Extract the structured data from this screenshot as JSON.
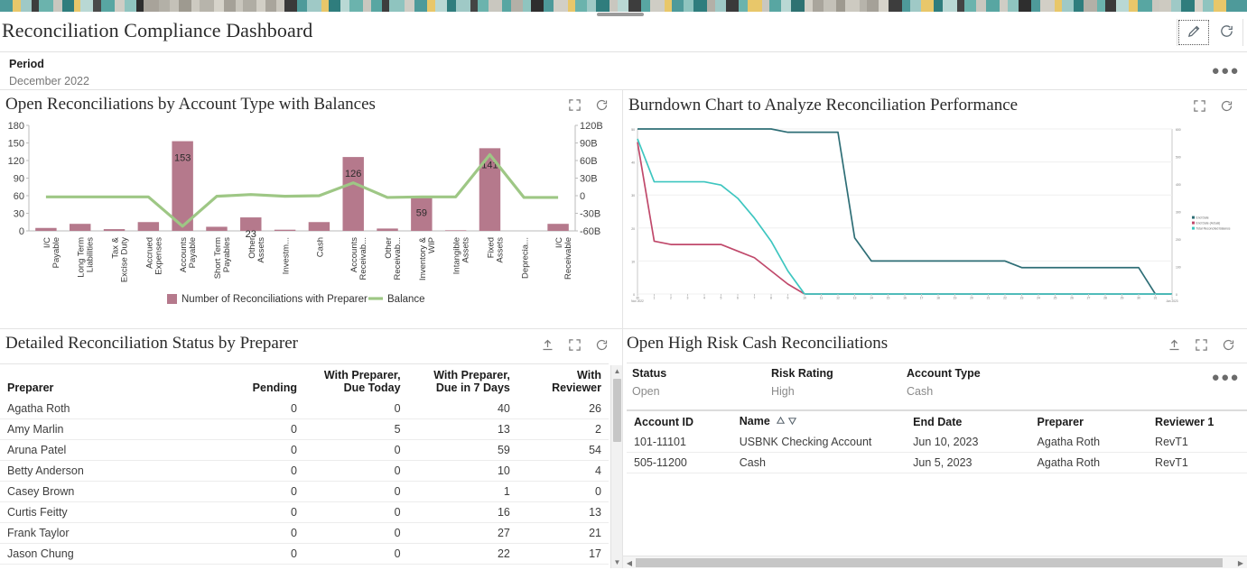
{
  "header": {
    "title": "Reconciliation Compliance Dashboard",
    "edit_icon": "pencil-icon",
    "refresh_icon": "refresh-icon"
  },
  "period": {
    "label": "Period",
    "value": "December 2022",
    "more_icon": "overflow-menu-icon"
  },
  "panel_bar": {
    "title": "Open Reconciliations by Account Type with Balances",
    "maximize_icon": "maximize-icon",
    "refresh_icon": "refresh-icon"
  },
  "panel_burndown": {
    "title": "Burndown Chart to Analyze Reconciliation Performance",
    "maximize_icon": "maximize-icon",
    "refresh_icon": "refresh-icon"
  },
  "panel_preparer": {
    "title": "Detailed Reconciliation Status by Preparer",
    "export_icon": "export-icon",
    "maximize_icon": "maximize-icon",
    "refresh_icon": "refresh-icon",
    "columns": [
      "Preparer",
      "Pending",
      "With Preparer, Due Today",
      "With Preparer, Due in 7 Days",
      "With Reviewer"
    ],
    "rows": [
      {
        "preparer": "Agatha Roth",
        "pending": "0",
        "due_today": "0",
        "due_7days": "40",
        "with_reviewer": "26"
      },
      {
        "preparer": "Amy Marlin",
        "pending": "0",
        "due_today": "5",
        "due_7days": "13",
        "with_reviewer": "2"
      },
      {
        "preparer": "Aruna Patel",
        "pending": "0",
        "due_today": "0",
        "due_7days": "59",
        "with_reviewer": "54"
      },
      {
        "preparer": "Betty Anderson",
        "pending": "0",
        "due_today": "0",
        "due_7days": "10",
        "with_reviewer": "4"
      },
      {
        "preparer": "Casey Brown",
        "pending": "0",
        "due_today": "0",
        "due_7days": "1",
        "with_reviewer": "0"
      },
      {
        "preparer": "Curtis Feitty",
        "pending": "0",
        "due_today": "0",
        "due_7days": "16",
        "with_reviewer": "13"
      },
      {
        "preparer": "Frank Taylor",
        "pending": "0",
        "due_today": "0",
        "due_7days": "27",
        "with_reviewer": "21"
      },
      {
        "preparer": "Jason Chung",
        "pending": "0",
        "due_today": "0",
        "due_7days": "22",
        "with_reviewer": "17"
      }
    ]
  },
  "panel_highrisk": {
    "title": "Open High Risk Cash Reconciliations",
    "export_icon": "export-icon",
    "maximize_icon": "maximize-icon",
    "refresh_icon": "refresh-icon",
    "more_icon": "overflow-menu-icon",
    "filters": [
      {
        "label": "Status",
        "value": "Open"
      },
      {
        "label": "Risk Rating",
        "value": "High"
      },
      {
        "label": "Account Type",
        "value": "Cash"
      }
    ],
    "columns": [
      "Account ID",
      "Name",
      "End Date",
      "Preparer",
      "Reviewer 1"
    ],
    "sort_asc_icon": "sort-ascending-icon",
    "sort_desc_icon": "sort-descending-icon",
    "rows": [
      {
        "account_id": "101-11101",
        "name": "USBNK Checking Account",
        "end_date": "Jun 10, 2023",
        "preparer": "Agatha Roth",
        "reviewer1": "RevT1"
      },
      {
        "account_id": "505-11200",
        "name": "Cash",
        "end_date": "Jun 5, 2023",
        "preparer": "Agatha Roth",
        "reviewer1": "RevT1"
      }
    ]
  },
  "colors": {
    "bar": "#b5798c",
    "balance_line": "#9ec785",
    "burn_end_date": "#2e6e76",
    "burn_end_date_actual": "#c0496b",
    "burn_total_balance": "#3ec6c0",
    "link": "#1a73b7"
  },
  "chart_data": [
    {
      "type": "bar",
      "title": "Open Reconciliations by Account Type with Balances",
      "xlabel": "",
      "ylabel": "",
      "ylim": [
        0,
        180
      ],
      "yticks": [
        "0",
        "30",
        "60",
        "90",
        "120",
        "150",
        "180"
      ],
      "y2lim": [
        -60,
        120
      ],
      "y2ticks": [
        "-60B",
        "-30B",
        "0",
        "30B",
        "60B",
        "90B",
        "120B"
      ],
      "grid": false,
      "legend": [
        "Number of Reconciliations with Preparer",
        "Balance"
      ],
      "legend_position": "bottom",
      "categories": [
        "I/C Payable",
        "Long Term Liabilities",
        "Tax & Excise Duty",
        "Accrued Expenses",
        "Accounts Payable",
        "Short Term Payables",
        "Other Assets",
        "Investm...",
        "Cash",
        "Accounts Receivab...",
        "Other Receivab...",
        "Inventory & WIP",
        "Intangible Assets",
        "Fixed Assets",
        "Deprecia...",
        "I/C Receivable"
      ],
      "series": [
        {
          "name": "Number of Reconciliations with Preparer",
          "type": "bar",
          "values": [
            5,
            12,
            3,
            15,
            153,
            7,
            23,
            2,
            15,
            126,
            4,
            59,
            1,
            141,
            0,
            12
          ],
          "labels": [
            "",
            "",
            "",
            "",
            "153",
            "",
            "23",
            "",
            "",
            "126",
            "",
            "59",
            "",
            "141",
            "",
            ""
          ]
        },
        {
          "name": "Balance",
          "type": "line",
          "values": [
            -2,
            -2,
            -2,
            -2,
            -52,
            -1,
            2,
            -1,
            0,
            22,
            -3,
            -2,
            -2,
            70,
            -3,
            -3
          ]
        }
      ]
    },
    {
      "type": "line",
      "title": "Burndown Chart to Analyze Reconciliation Performance",
      "xlabel": "",
      "ylabel": "",
      "ylim": [
        0,
        50
      ],
      "yticks": [
        "0",
        "10",
        "20",
        "30",
        "40",
        "50"
      ],
      "y2lim": [
        0,
        600
      ],
      "y2ticks": [
        "0",
        "100",
        "200",
        "300",
        "400",
        "500",
        "600"
      ],
      "grid": true,
      "legend": [
        "End Date",
        "End Date (Actual)",
        "Total Reconciled Balance"
      ],
      "legend_position": "right",
      "x": [
        "30 Nov 2022",
        "1 Dec",
        "2",
        "3",
        "4",
        "5",
        "6",
        "7",
        "8",
        "9",
        "10",
        "11",
        "12",
        "13",
        "14",
        "15",
        "16",
        "17",
        "18",
        "19",
        "20",
        "21",
        "22",
        "23",
        "24",
        "25",
        "26",
        "27",
        "28",
        "29",
        "30",
        "31",
        "1 Jan 2023"
      ],
      "series": [
        {
          "name": "End Date",
          "color": "#2e6e76",
          "values": [
            50,
            50,
            50,
            50,
            50,
            50,
            50,
            50,
            50,
            49,
            49,
            49,
            49,
            17,
            10,
            10,
            10,
            10,
            10,
            10,
            10,
            10,
            10,
            8,
            8,
            8,
            8,
            8,
            8,
            8,
            8,
            0,
            0
          ]
        },
        {
          "name": "End Date (Actual)",
          "color": "#c0496b",
          "values": [
            46,
            16,
            15,
            15,
            15,
            15,
            13,
            11,
            7,
            3,
            0,
            0,
            0,
            0,
            0,
            0,
            0,
            0,
            0,
            0,
            0,
            0,
            0,
            0,
            0,
            0,
            0,
            0,
            0,
            0,
            0,
            0,
            0
          ]
        },
        {
          "name": "Total Reconciled Balance",
          "color": "#3ec6c0",
          "values": [
            47,
            34,
            34,
            34,
            34,
            33,
            29,
            23,
            16,
            7,
            0,
            0,
            0,
            0,
            0,
            0,
            0,
            0,
            0,
            0,
            0,
            0,
            0,
            0,
            0,
            0,
            0,
            0,
            0,
            0,
            0,
            0,
            0
          ]
        }
      ]
    }
  ]
}
